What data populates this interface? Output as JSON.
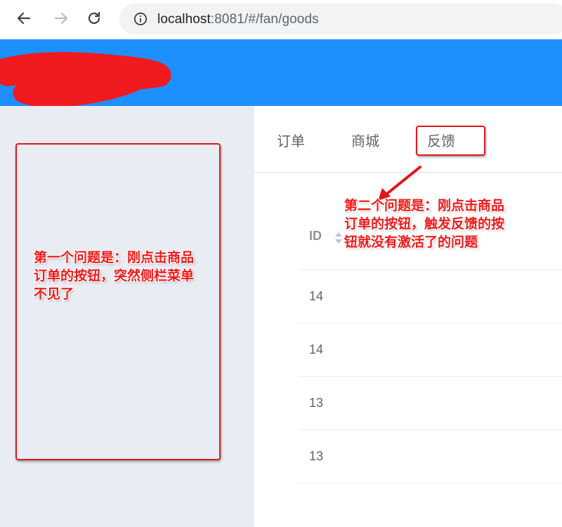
{
  "browser": {
    "back_icon": "arrow-left-icon",
    "forward_icon": "arrow-right-icon",
    "reload_icon": "reload-icon",
    "info_icon": "info-icon",
    "url_host": "localhost",
    "url_rest": ":8081/#/fan/goods"
  },
  "header": {
    "title_redacted": true,
    "accent": "#1e8fff"
  },
  "tabs": [
    {
      "label": "订单"
    },
    {
      "label": "商城"
    },
    {
      "label": "反馈"
    }
  ],
  "table": {
    "columns": [
      {
        "label": "ID",
        "sortable": true
      }
    ],
    "rows": [
      {
        "id": "14"
      },
      {
        "id": "14"
      },
      {
        "id": "13"
      },
      {
        "id": "13"
      }
    ]
  },
  "annotations": {
    "color": "#e0161b",
    "note1": "第一个问题是：刚点击商品订单的按钮，突然侧栏菜单不见了",
    "note2": "第二个问题是：刚点击商品订单的按钮，触发反馈的按钮就没有激活了的问题"
  }
}
